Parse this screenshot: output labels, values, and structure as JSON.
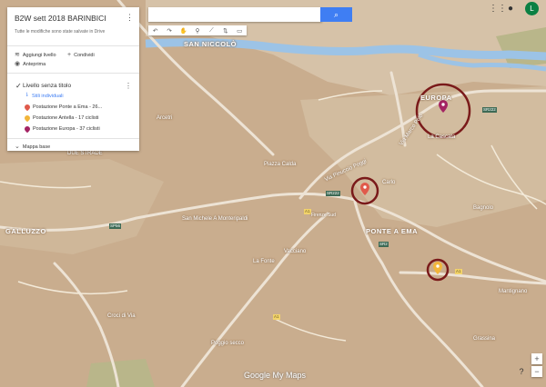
{
  "map_title": "B2W sett 2018 BARINBICI",
  "saved_note": "Tutte le modifiche sono state salvate in Drive",
  "actions": {
    "add_layer": "Aggiungi livello",
    "share": "Condividi",
    "preview": "Anteprima"
  },
  "layer": {
    "title": "Livello senza titolo",
    "styles_link": "Stili individuali",
    "items": [
      {
        "label": "Postazione Ponte a Ema - 26...",
        "color": "#e05a4b"
      },
      {
        "label": "Postazione Antella - 17 ciclisti",
        "color": "#f2b53a"
      },
      {
        "label": "Postazione Europa - 37 ciclisti",
        "color": "#a42363"
      }
    ]
  },
  "base_map": "Mappa base",
  "colors": {
    "land": "#c9ad8e",
    "water": "#9cc3e6",
    "road_major": "#ede3d5",
    "park": "#b9b68a",
    "circle": "#7a1a1a",
    "accent": "#3f7ef3"
  },
  "labels": {
    "san_niccolo": "SAN NICCOLÒ",
    "europa": "EUROPA",
    "ponte_a_ema": "PONTE A EMA",
    "galluzzo": "GALLUZZO",
    "piazza_calda": "Piazza Calda",
    "via_marco_polo": "Via Marco Polo",
    "via_pinuccio_poggi": "Via Pinuccio Poggi",
    "carlo": "Carlo",
    "la_cascata": "La Cascata",
    "arcetri": "Arcetri",
    "san_michele": "San Michele A Monteripaldi",
    "vacciano": "Vacciano",
    "la_fonte": "La Fonte",
    "bagnolo": "Bagnolo",
    "croci_di_via": "Croci di Via",
    "poggio_secco": "Poggio secco",
    "mantignano": "Mantignano",
    "grassina": "Grassina",
    "due_strade": "DUE STRADE",
    "firenze_sud": "Firenze Sud"
  },
  "roads": [
    "SR222",
    "SR2",
    "SR222",
    "A1",
    "A1",
    "A1",
    "SP56"
  ],
  "branding": "Google My Maps",
  "zoom": {
    "in": "+",
    "out": "−",
    "help": "?"
  }
}
